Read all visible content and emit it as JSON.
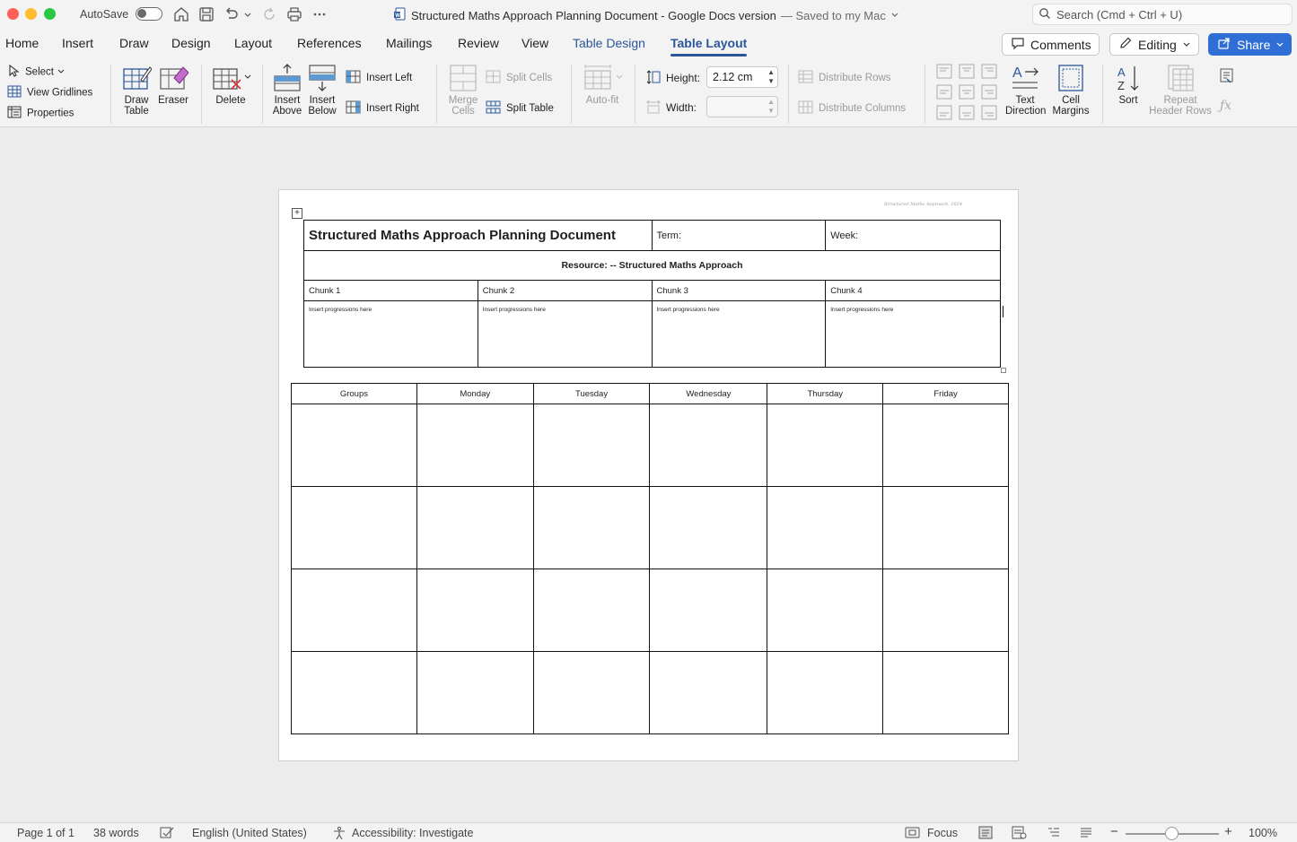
{
  "titlebar": {
    "autosave_label": "AutoSave",
    "doc_title": "Structured Maths Approach Planning Document - Google Docs version",
    "saved_status": "— Saved to my Mac",
    "search_placeholder": "Search (Cmd + Ctrl + U)"
  },
  "menu": {
    "tabs": [
      "Home",
      "Insert",
      "Draw",
      "Design",
      "Layout",
      "References",
      "Mailings",
      "Review",
      "View",
      "Table Design",
      "Table Layout"
    ],
    "active": "Table Layout",
    "comments_label": "Comments",
    "editing_label": "Editing",
    "share_label": "Share"
  },
  "ribbon": {
    "select": "Select",
    "view_gridlines": "View Gridlines",
    "properties": "Properties",
    "draw_table_1": "Draw",
    "draw_table_2": "Table",
    "eraser": "Eraser",
    "delete": "Delete",
    "insert_above_1": "Insert",
    "insert_above_2": "Above",
    "insert_below_1": "Insert",
    "insert_below_2": "Below",
    "insert_left": "Insert Left",
    "insert_right": "Insert Right",
    "merge_cells_1": "Merge",
    "merge_cells_2": "Cells",
    "split_cells": "Split Cells",
    "split_table": "Split Table",
    "auto_fit": "Auto-fit",
    "height_label": "Height:",
    "height_value": "2.12 cm",
    "width_label": "Width:",
    "width_value": "",
    "distribute_rows": "Distribute Rows",
    "distribute_columns": "Distribute Columns",
    "text_direction_1": "Text",
    "text_direction_2": "Direction",
    "cell_margins_1": "Cell",
    "cell_margins_2": "Margins",
    "sort": "Sort",
    "repeat_header_1": "Repeat",
    "repeat_header_2": "Header Rows"
  },
  "document": {
    "watermark": "Structured Maths Approach, 2024",
    "title": "Structured Maths Approach Planning Document",
    "term_label": "Term:",
    "week_label": "Week:",
    "resource_label": "Resource:  -- Structured Maths Approach",
    "chunks": [
      "Chunk 1",
      "Chunk 2",
      "Chunk 3",
      "Chunk 4"
    ],
    "progression_text": "Insert progressions here",
    "week_headers": [
      "Groups",
      "Monday",
      "Tuesday",
      "Wednesday",
      "Thursday",
      "Friday"
    ]
  },
  "status": {
    "page": "Page 1 of 1",
    "words": "38 words",
    "language": "English (United States)",
    "accessibility": "Accessibility: Investigate",
    "focus": "Focus",
    "zoom": "100%"
  },
  "colors": {
    "accent": "#2b579a",
    "share": "#2f6fd5"
  }
}
